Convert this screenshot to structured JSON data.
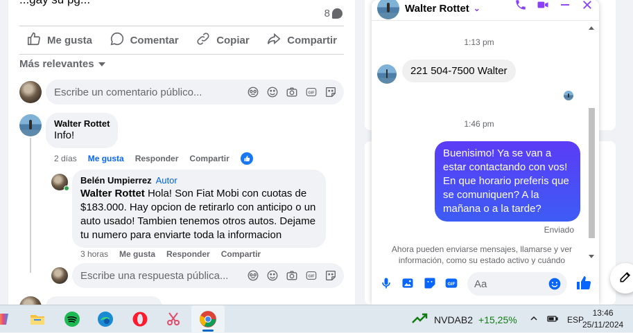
{
  "post": {
    "top_text": "...gay su pg...",
    "comment_count": "8",
    "actions": {
      "like": "Me gusta",
      "comment": "Comentar",
      "copy": "Copiar",
      "share": "Compartir"
    },
    "sort_label": "Más relevantes",
    "comment_placeholder": "Escribe un comentario público...",
    "comments": [
      {
        "author": "Walter Rottet",
        "text": "Info!",
        "time": "2 días",
        "like": "Me gusta",
        "reply": "Responder",
        "share": "Compartir"
      }
    ],
    "reply": {
      "author": "Belén Umpierrez",
      "badge": "Autor",
      "mention": "Walter Rottet",
      "text": " Hola! Son Fiat Mobi con cuotas de $183.000. Hay opcion de retirarlo con anticipo o un auto usado! Tambien tenemos otros autos. Dejame tu numero para enviarte toda la informacion",
      "time": "3 horas",
      "like": "Me gusta",
      "reply": "Responder",
      "share": "Compartir"
    },
    "reply_placeholder": "Escribe una respuesta pública..."
  },
  "chat": {
    "name": "Walter Rottet",
    "messages": [
      {
        "type": "time",
        "text": "1:13 pm"
      },
      {
        "type": "in",
        "text": "221 504-7500 Walter"
      },
      {
        "type": "time",
        "text": "1:46 pm"
      },
      {
        "type": "out",
        "text": "Buenisimo! Ya se van a estar contactando con vos! En que horario preferis que se comuniquen? A la mañana o a la tarde?"
      }
    ],
    "sent_label": "Enviado",
    "notice": "Ahora pueden enviarse mensajes, llamarse y ver información, como su estado activo y cuándo",
    "composer_placeholder": "Aa"
  },
  "taskbar": {
    "ticker_symbol": "NVDAB2",
    "ticker_change": "+15,25%",
    "language": "ESP",
    "time": "13:46",
    "date": "25/11/2024"
  },
  "colors": {
    "accent": "#0866ff",
    "messenger": "#8a3ffc",
    "outgoing_bubble": "#4a3cf5",
    "ticker_green": "#107c10"
  }
}
